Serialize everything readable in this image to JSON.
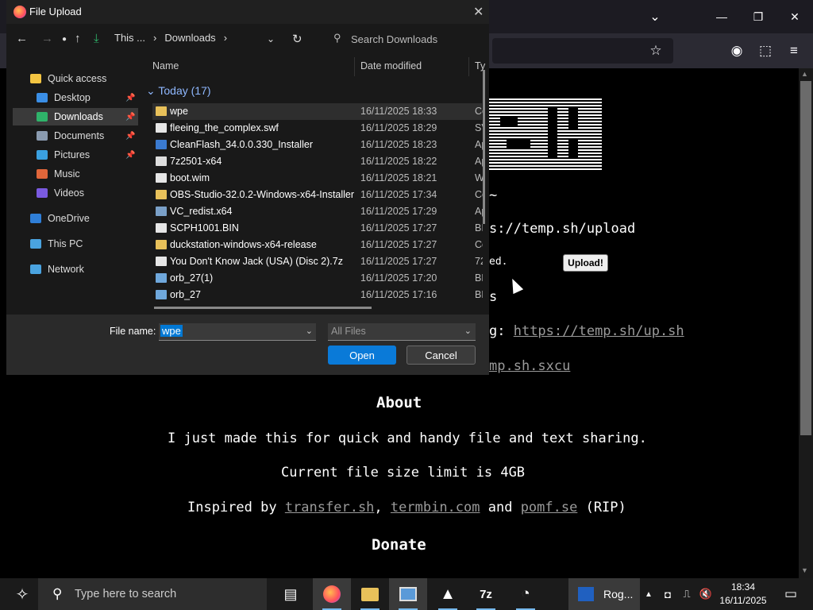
{
  "dialog": {
    "title": "File Upload",
    "breadcrumb": [
      "This ...",
      "Downloads"
    ],
    "search_placeholder": "Search Downloads",
    "nav_items": [
      {
        "label": "Quick access",
        "icon": "star-icon",
        "color": "#f4c542"
      },
      {
        "label": "Desktop",
        "icon": "desktop-icon",
        "color": "#3a8ee6",
        "pinned": true
      },
      {
        "label": "Downloads",
        "icon": "download-icon",
        "color": "#2fb36a",
        "pinned": true,
        "selected": true
      },
      {
        "label": "Documents",
        "icon": "documents-icon",
        "color": "#8a9bb0",
        "pinned": true
      },
      {
        "label": "Pictures",
        "icon": "pictures-icon",
        "color": "#3aa0e0",
        "pinned": true
      },
      {
        "label": "Music",
        "icon": "music-icon",
        "color": "#e0663a"
      },
      {
        "label": "Videos",
        "icon": "videos-icon",
        "color": "#7a5ae0"
      },
      {
        "label": "OneDrive",
        "icon": "onedrive-icon",
        "color": "#2f7fd8"
      },
      {
        "label": "This PC",
        "icon": "computer-icon",
        "color": "#4aa3e0"
      },
      {
        "label": "Network",
        "icon": "network-icon",
        "color": "#4aa3e0"
      }
    ],
    "columns": {
      "name": "Name",
      "date": "Date modified",
      "type": "Ty"
    },
    "group_label": "Today (17)",
    "files": [
      {
        "name": "wpe",
        "date": "16/11/2025 18:33",
        "type": "Ce",
        "icon": "folder-icon",
        "color": "#e8c15a"
      },
      {
        "name": "fleeing_the_complex.swf",
        "date": "16/11/2025 18:29",
        "type": "SV",
        "icon": "file-icon",
        "color": "#e6e6e6"
      },
      {
        "name": "CleanFlash_34.0.0.330_Installer",
        "date": "16/11/2025 18:23",
        "type": "Ap",
        "icon": "installer-icon",
        "color": "#3a7ad0"
      },
      {
        "name": "7z2501-x64",
        "date": "16/11/2025 18:22",
        "type": "Ap",
        "icon": "7zip-icon",
        "color": "#dddddd"
      },
      {
        "name": "boot.wim",
        "date": "16/11/2025 18:21",
        "type": "W",
        "icon": "file-icon",
        "color": "#e6e6e6"
      },
      {
        "name": "OBS-Studio-32.0.2-Windows-x64-Installer",
        "date": "16/11/2025 17:34",
        "type": "Ce",
        "icon": "folder-icon",
        "color": "#e8c15a"
      },
      {
        "name": "VC_redist.x64",
        "date": "16/11/2025 17:29",
        "type": "Ap",
        "icon": "installer-icon",
        "color": "#7aa0c8"
      },
      {
        "name": "SCPH1001.BIN",
        "date": "16/11/2025 17:27",
        "type": "BI",
        "icon": "file-icon",
        "color": "#e6e6e6"
      },
      {
        "name": "duckstation-windows-x64-release",
        "date": "16/11/2025 17:27",
        "type": "Ce",
        "icon": "folder-icon",
        "color": "#e8c15a"
      },
      {
        "name": "You Don't Know Jack (USA) (Disc 2).7z",
        "date": "16/11/2025 17:27",
        "type": "72",
        "icon": "file-icon",
        "color": "#e6e6e6"
      },
      {
        "name": "orb_27(1)",
        "date": "16/11/2025 17:20",
        "type": "BN",
        "icon": "image-file-icon",
        "color": "#6fa8dc"
      },
      {
        "name": "orb_27",
        "date": "16/11/2025 17:16",
        "type": "BN",
        "icon": "image-file-icon",
        "color": "#6fa8dc"
      }
    ],
    "file_name_label": "File name:",
    "file_name_value": "wpe",
    "file_type": "All Files",
    "open_label": "Open",
    "cancel_label": "Cancel"
  },
  "page": {
    "url_text": "s://temp.sh/upload",
    "tilde": "~",
    "upload_button": "Upload!",
    "ed_text": "ed.",
    "s_text": "s",
    "g_prefix": "g: ",
    "g_link": "https://temp.sh/up.sh",
    "sxcu_link": "mp.sh.sxcu",
    "about_heading": "About",
    "about_text": "I just made this for quick and handy file and text sharing.",
    "limit_text": "Current file size limit is 4GB",
    "inspired_prefix": "Inspired by ",
    "link1": "transfer.sh",
    "sep1": ", ",
    "link2": "termbin.com",
    "sep2": " and ",
    "link3": "pomf.se",
    "inspired_suffix": " (RIP)",
    "donate_heading": "Donate"
  },
  "taskbar": {
    "search_placeholder": "Type here to search",
    "running_app": "Rog...",
    "time": "18:34",
    "date": "16/11/2025"
  },
  "colors": {
    "accent": "#0a7ad8",
    "link": "#9a9a9a",
    "dialog_bg": "#191919"
  }
}
